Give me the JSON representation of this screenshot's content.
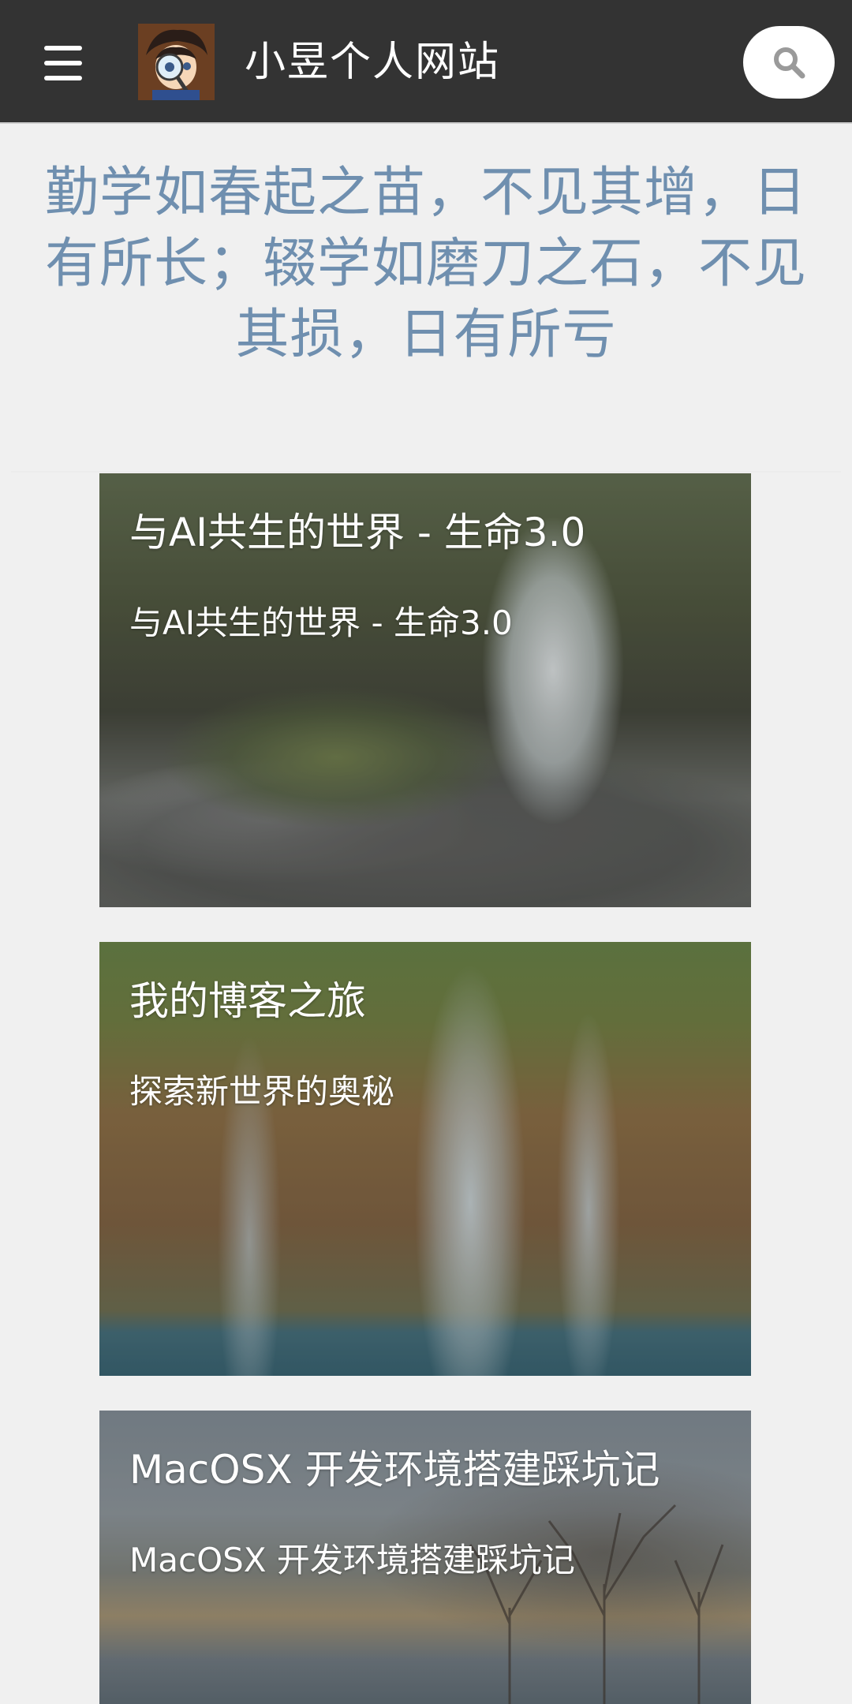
{
  "header": {
    "menu_label": "menu",
    "site_title": "小昱个人网站",
    "avatar_alt": "avatar",
    "search_label": "search"
  },
  "motto": "勤学如春起之苗，不见其增，日有所长；辍学如磨刀之石，不见其损，日有所亏",
  "posts": [
    {
      "title": "与AI共生的世界 - 生命3.0",
      "subtitle": "与AI共生的世界 - 生命3.0",
      "image": "waterfall-forest"
    },
    {
      "title": "我的博客之旅",
      "subtitle": "探索新世界的奥秘",
      "image": "waterfall-cliff"
    },
    {
      "title": "MacOSX 开发环境搭建踩坑记",
      "subtitle": "MacOSX 开发环境搭建踩坑记",
      "image": "lake-trees"
    }
  ],
  "colors": {
    "header_bg": "#333333",
    "motto": "#6f8faf",
    "page_bg": "#f0f0f0"
  }
}
